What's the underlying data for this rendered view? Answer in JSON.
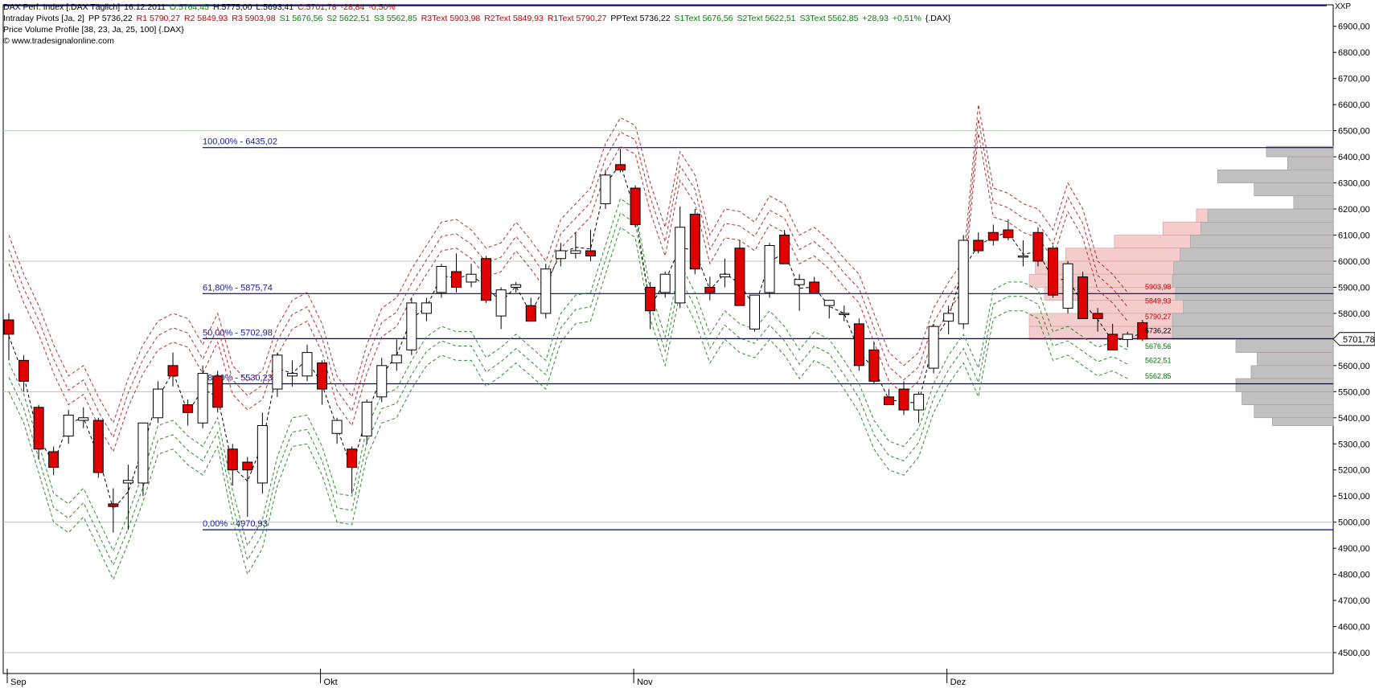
{
  "header": {
    "line1": {
      "symbol": "DAX Perf. Index [.DAX  Täglich]",
      "date": "16.12.2011",
      "open": "O:5764,45",
      "high": "H:5775,00",
      "low": "L:5693,41",
      "close": "C:5701,78",
      "change": "-28,84",
      "change_pct": "-0,50%"
    },
    "line2": {
      "name": "Intraday Pivots [Ja, 2]",
      "pp": "PP 5736,22",
      "r1": "R1 5790,27",
      "r2": "R2 5849,93",
      "r3": "R3 5903,98",
      "s1": "S1 5676,56",
      "s2": "S2 5622,51",
      "s3": "S3 5562,85",
      "r3text": "R3Text 5903,98",
      "r2text": "R2Text 5849,93",
      "r1text": "R1Text 5790,27",
      "pptext": "PPText 5736,22",
      "s1text": "S1Text 5676,56",
      "s2text": "S2Text 5622,51",
      "s3text": "S3Text 5562,85",
      "diff": "+28,93",
      "diff_pct": "+0,51%",
      "sym": "{.DAX}"
    },
    "line3": "Price Volume Profile [38, 23, Ja, 25, 100] {.DAX}",
    "line4": "© www.tradesignalonline.com",
    "corner": "XXP"
  },
  "colors": {
    "up": "#ffffff",
    "down": "#e00000",
    "fib_line": "#00008b",
    "res_dash": "#b03030",
    "sup_dash": "#2e8b2e",
    "profile_pink": "#f4cccc",
    "profile_gray": "#c0c0c0"
  },
  "chart_data": {
    "type": "candlestick",
    "title": "DAX Perf. Index [.DAX  Täglich]",
    "ylim": [
      4420,
      6970
    ],
    "y_ticks": [
      4500,
      4600,
      4700,
      4800,
      4900,
      5000,
      5100,
      5200,
      5300,
      5400,
      5500,
      5600,
      5700,
      5800,
      5900,
      6000,
      6100,
      6200,
      6300,
      6400,
      6500,
      6600,
      6700,
      6800,
      6900
    ],
    "y_tick_labels": [
      "4500,00",
      "4600,00",
      "4700,00",
      "4800,00",
      "4900,00",
      "5000,00",
      "5100,00",
      "5200,00",
      "5300,00",
      "5400,00",
      "5500,00",
      "5600,00",
      "5700,00",
      "5800,00",
      "5900,00",
      "6000,00",
      "6100,00",
      "6200,00",
      "6300,00",
      "6400,00",
      "6500,00",
      "6600,00",
      "6700,00",
      "6800,00",
      "6900,00"
    ],
    "x_labels": [
      {
        "label": "Sep",
        "index": 0
      },
      {
        "label": "Okt",
        "index": 21
      },
      {
        "label": "Nov",
        "index": 42
      },
      {
        "label": "Dez",
        "index": 63
      }
    ],
    "last_price_label": "5701,78",
    "candles": [
      {
        "o": 5775,
        "h": 5800,
        "l": 5620,
        "c": 5720
      },
      {
        "o": 5620,
        "h": 5640,
        "l": 5500,
        "c": 5540
      },
      {
        "o": 5440,
        "h": 5450,
        "l": 5240,
        "c": 5280
      },
      {
        "o": 5270,
        "h": 5290,
        "l": 5180,
        "c": 5210
      },
      {
        "o": 5330,
        "h": 5430,
        "l": 5300,
        "c": 5410
      },
      {
        "o": 5390,
        "h": 5440,
        "l": 5360,
        "c": 5400
      },
      {
        "o": 5390,
        "h": 5400,
        "l": 5170,
        "c": 5190
      },
      {
        "o": 5070,
        "h": 5130,
        "l": 4960,
        "c": 5060
      },
      {
        "o": 5150,
        "h": 5220,
        "l": 4970,
        "c": 5160
      },
      {
        "o": 5150,
        "h": 5380,
        "l": 5100,
        "c": 5380
      },
      {
        "o": 5400,
        "h": 5540,
        "l": 5380,
        "c": 5510
      },
      {
        "o": 5600,
        "h": 5650,
        "l": 5520,
        "c": 5560
      },
      {
        "o": 5450,
        "h": 5470,
        "l": 5370,
        "c": 5420
      },
      {
        "o": 5380,
        "h": 5600,
        "l": 5360,
        "c": 5570
      },
      {
        "o": 5560,
        "h": 5580,
        "l": 5420,
        "c": 5440
      },
      {
        "o": 5280,
        "h": 5300,
        "l": 5140,
        "c": 5200
      },
      {
        "o": 5230,
        "h": 5250,
        "l": 5020,
        "c": 5200
      },
      {
        "o": 5150,
        "h": 5420,
        "l": 5110,
        "c": 5370
      },
      {
        "o": 5510,
        "h": 5650,
        "l": 5480,
        "c": 5640
      },
      {
        "o": 5560,
        "h": 5620,
        "l": 5520,
        "c": 5570
      },
      {
        "o": 5560,
        "h": 5680,
        "l": 5540,
        "c": 5650
      },
      {
        "o": 5610,
        "h": 5620,
        "l": 5450,
        "c": 5510
      },
      {
        "o": 5340,
        "h": 5400,
        "l": 5300,
        "c": 5390
      },
      {
        "o": 5280,
        "h": 5290,
        "l": 5110,
        "c": 5210
      },
      {
        "o": 5330,
        "h": 5470,
        "l": 5300,
        "c": 5460
      },
      {
        "o": 5480,
        "h": 5630,
        "l": 5460,
        "c": 5600
      },
      {
        "o": 5610,
        "h": 5700,
        "l": 5580,
        "c": 5640
      },
      {
        "o": 5660,
        "h": 5860,
        "l": 5640,
        "c": 5840
      },
      {
        "o": 5800,
        "h": 5860,
        "l": 5770,
        "c": 5840
      },
      {
        "o": 5880,
        "h": 5990,
        "l": 5860,
        "c": 5980
      },
      {
        "o": 5960,
        "h": 6030,
        "l": 5880,
        "c": 5900
      },
      {
        "o": 5920,
        "h": 5990,
        "l": 5900,
        "c": 5950
      },
      {
        "o": 6010,
        "h": 6020,
        "l": 5840,
        "c": 5850
      },
      {
        "o": 5790,
        "h": 5900,
        "l": 5740,
        "c": 5890
      },
      {
        "o": 5900,
        "h": 5920,
        "l": 5880,
        "c": 5910
      },
      {
        "o": 5830,
        "h": 5860,
        "l": 5770,
        "c": 5770
      },
      {
        "o": 5800,
        "h": 5990,
        "l": 5780,
        "c": 5970
      },
      {
        "o": 6010,
        "h": 6070,
        "l": 5980,
        "c": 6040
      },
      {
        "o": 6030,
        "h": 6110,
        "l": 6010,
        "c": 6040
      },
      {
        "o": 6040,
        "h": 6120,
        "l": 6000,
        "c": 6020
      },
      {
        "o": 6220,
        "h": 6350,
        "l": 6200,
        "c": 6330
      },
      {
        "o": 6370,
        "h": 6430,
        "l": 6340,
        "c": 6350
      },
      {
        "o": 6280,
        "h": 6290,
        "l": 6130,
        "c": 6140
      },
      {
        "o": 5900,
        "h": 5920,
        "l": 5740,
        "c": 5810
      },
      {
        "o": 5880,
        "h": 5960,
        "l": 5860,
        "c": 5950
      },
      {
        "o": 5840,
        "h": 6210,
        "l": 5820,
        "c": 6130
      },
      {
        "o": 6180,
        "h": 6200,
        "l": 5950,
        "c": 5970
      },
      {
        "o": 5900,
        "h": 5940,
        "l": 5850,
        "c": 5880
      },
      {
        "o": 5940,
        "h": 6010,
        "l": 5900,
        "c": 5950
      },
      {
        "o": 6050,
        "h": 6080,
        "l": 5830,
        "c": 5830
      },
      {
        "o": 5740,
        "h": 5870,
        "l": 5730,
        "c": 5870
      },
      {
        "o": 5880,
        "h": 6070,
        "l": 5860,
        "c": 6060
      },
      {
        "o": 6100,
        "h": 6120,
        "l": 5990,
        "c": 5990
      },
      {
        "o": 5910,
        "h": 5950,
        "l": 5810,
        "c": 5930
      },
      {
        "o": 5920,
        "h": 5940,
        "l": 5880,
        "c": 5880
      },
      {
        "o": 5830,
        "h": 5850,
        "l": 5780,
        "c": 5850
      },
      {
        "o": 5800,
        "h": 5830,
        "l": 5770,
        "c": 5800
      },
      {
        "o": 5760,
        "h": 5780,
        "l": 5580,
        "c": 5600
      },
      {
        "o": 5660,
        "h": 5690,
        "l": 5530,
        "c": 5540
      },
      {
        "o": 5480,
        "h": 5510,
        "l": 5450,
        "c": 5450
      },
      {
        "o": 5510,
        "h": 5540,
        "l": 5410,
        "c": 5430
      },
      {
        "o": 5430,
        "h": 5500,
        "l": 5380,
        "c": 5490
      },
      {
        "o": 5590,
        "h": 5760,
        "l": 5570,
        "c": 5750
      },
      {
        "o": 5770,
        "h": 5830,
        "l": 5720,
        "c": 5800
      },
      {
        "o": 5760,
        "h": 6100,
        "l": 5740,
        "c": 6080
      },
      {
        "o": 6080,
        "h": 6110,
        "l": 6030,
        "c": 6040
      },
      {
        "o": 6110,
        "h": 6140,
        "l": 6060,
        "c": 6080
      },
      {
        "o": 6120,
        "h": 6160,
        "l": 6080,
        "c": 6090
      },
      {
        "o": 6020,
        "h": 6080,
        "l": 5980,
        "c": 6020
      },
      {
        "o": 6110,
        "h": 6130,
        "l": 5980,
        "c": 6000
      },
      {
        "o": 6050,
        "h": 6060,
        "l": 5860,
        "c": 5870
      },
      {
        "o": 5820,
        "h": 6000,
        "l": 5800,
        "c": 5990
      },
      {
        "o": 5940,
        "h": 5960,
        "l": 5780,
        "c": 5780
      },
      {
        "o": 5800,
        "h": 5820,
        "l": 5730,
        "c": 5780
      },
      {
        "o": 5720,
        "h": 5760,
        "l": 5660,
        "c": 5660
      },
      {
        "o": 5700,
        "h": 5730,
        "l": 5670,
        "c": 5720
      },
      {
        "o": 5764.45,
        "h": 5775,
        "l": 5693.41,
        "c": 5701.78
      }
    ],
    "pivot_upper_path": [
      6100,
      5950,
      5830,
      5680,
      5560,
      5600,
      5480,
      5380,
      5550,
      5680,
      5770,
      5800,
      5780,
      5680,
      5800,
      5600,
      5540,
      5580,
      5750,
      5850,
      5880,
      5760,
      5560,
      5480,
      5680,
      5820,
      5860,
      5970,
      6060,
      6150,
      6160,
      6120,
      6050,
      6070,
      6150,
      6080,
      6000,
      6160,
      6220,
      6280,
      6450,
      6550,
      6520,
      6300,
      6130,
      6420,
      6330,
      6100,
      6200,
      6190,
      6150,
      6250,
      6220,
      6100,
      6130,
      6080,
      6010,
      5950,
      5800,
      5650,
      5600,
      5650,
      5820,
      5920,
      6000,
      6600,
      6280,
      6260,
      6220,
      6200,
      6120,
      6300,
      6200,
      6000,
      5950,
      5880
    ],
    "pivot_lower_path": [
      5500,
      5380,
      5190,
      5000,
      4960,
      5020,
      4900,
      4780,
      4920,
      5080,
      5260,
      5280,
      5220,
      5180,
      5290,
      5010,
      4800,
      4900,
      5140,
      5290,
      5300,
      5180,
      5000,
      4990,
      5250,
      5380,
      5400,
      5510,
      5600,
      5640,
      5620,
      5620,
      5520,
      5560,
      5610,
      5560,
      5510,
      5690,
      5760,
      5770,
      5950,
      6130,
      6090,
      5780,
      5600,
      5880,
      5770,
      5610,
      5700,
      5650,
      5630,
      5700,
      5640,
      5550,
      5620,
      5590,
      5510,
      5420,
      5280,
      5200,
      5180,
      5250,
      5420,
      5530,
      5610,
      5480,
      5780,
      5810,
      5810,
      5780,
      5620,
      5640,
      5600,
      5560,
      5580,
      5550
    ],
    "fib_levels": [
      {
        "label": "100,00% - 6435,02",
        "value": 6435.02
      },
      {
        "label": "61,80% - 5875,74",
        "value": 5875.74
      },
      {
        "label": "50,00% - 5702,98",
        "value": 5702.98
      },
      {
        "label": "38,20% - 5530,23",
        "value": 5530.23
      },
      {
        "label": "0,00% - 4970,93",
        "value": 4970.93
      }
    ],
    "pivot_labels": [
      {
        "text": "5903,98",
        "value": 5903.98,
        "color": "red"
      },
      {
        "text": "5849,93",
        "value": 5849.93,
        "color": "red"
      },
      {
        "text": "5790,27",
        "value": 5790.27,
        "color": "red"
      },
      {
        "text": "5736,22",
        "value": 5736.22,
        "color": "black"
      },
      {
        "text": "5676,56",
        "value": 5676.56,
        "color": "green"
      },
      {
        "text": "5622,51",
        "value": 5622.51,
        "color": "green"
      },
      {
        "text": "5562,85",
        "value": 5562.85,
        "color": "green"
      }
    ],
    "volume_profile": [
      {
        "lo": 6400,
        "hi": 6440,
        "vol": 0.22
      },
      {
        "lo": 6350,
        "hi": 6400,
        "vol": 0.15
      },
      {
        "lo": 6300,
        "hi": 6350,
        "vol": 0.38
      },
      {
        "lo": 6250,
        "hi": 6300,
        "vol": 0.26
      },
      {
        "lo": 6200,
        "hi": 6250,
        "vol": 0.13
      },
      {
        "lo": 6150,
        "hi": 6200,
        "vol": 0.45
      },
      {
        "lo": 6100,
        "hi": 6150,
        "vol": 0.56
      },
      {
        "lo": 6050,
        "hi": 6100,
        "vol": 0.72
      },
      {
        "lo": 6000,
        "hi": 6050,
        "vol": 0.88
      },
      {
        "lo": 5950,
        "hi": 6000,
        "vol": 0.98
      },
      {
        "lo": 5900,
        "hi": 5950,
        "vol": 1.0
      },
      {
        "lo": 5850,
        "hi": 5900,
        "vol": 0.95
      },
      {
        "lo": 5800,
        "hi": 5850,
        "vol": 0.83
      },
      {
        "lo": 5750,
        "hi": 5800,
        "vol": 1.0
      },
      {
        "lo": 5700,
        "hi": 5750,
        "vol": 1.0
      },
      {
        "lo": 5650,
        "hi": 5700,
        "vol": 0.32
      },
      {
        "lo": 5600,
        "hi": 5650,
        "vol": 0.25
      },
      {
        "lo": 5550,
        "hi": 5600,
        "vol": 0.27
      },
      {
        "lo": 5500,
        "hi": 5550,
        "vol": 0.32
      },
      {
        "lo": 5450,
        "hi": 5500,
        "vol": 0.3
      },
      {
        "lo": 5400,
        "hi": 5450,
        "vol": 0.26
      },
      {
        "lo": 5370,
        "hi": 5400,
        "vol": 0.2
      }
    ]
  }
}
